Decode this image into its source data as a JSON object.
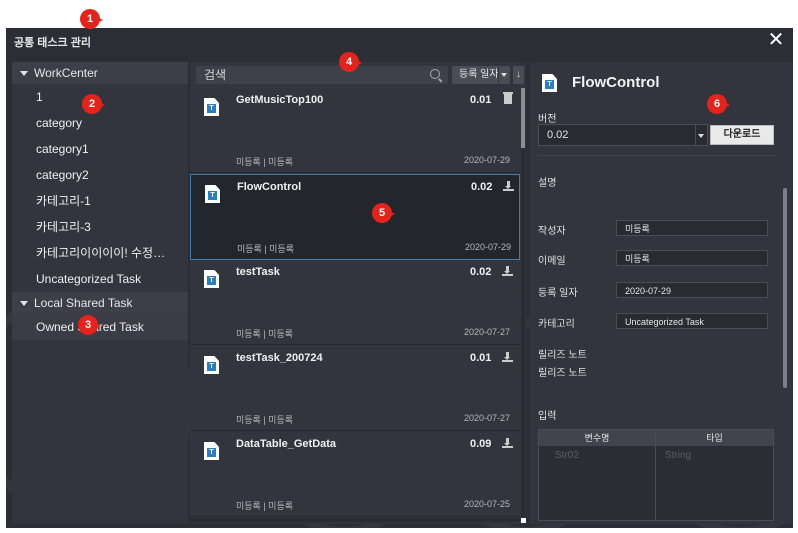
{
  "window": {
    "title": "공통 태스크 관리",
    "close_icon": "close-icon"
  },
  "markers": [
    "1",
    "2",
    "3",
    "4",
    "5",
    "6"
  ],
  "left_panel": {
    "groups": [
      {
        "label": "WorkCenter",
        "items": [
          "1",
          "category",
          "category1",
          "category2",
          "카테고리-1",
          "카테고리-3",
          "카테고리이이이이! 수정…",
          "Uncategorized Task"
        ]
      },
      {
        "label": "Local Shared Task",
        "items": [
          "Owned Shared Task"
        ]
      }
    ]
  },
  "middle_panel": {
    "search_placeholder": "검색",
    "sort_label": "등록 일자",
    "sort_dir_icon": "↓",
    "tasks": [
      {
        "name": "GetMusicTop100",
        "version": "0.01",
        "meta": "미등록 | 미등록",
        "date": "2020-07-29",
        "action": "trash-icon"
      },
      {
        "name": "FlowControl",
        "version": "0.02",
        "meta": "미등록 | 미등록",
        "date": "2020-07-29",
        "action": "download-icon",
        "selected": true
      },
      {
        "name": "testTask",
        "version": "0.02",
        "meta": "미등록 | 미등록",
        "date": "2020-07-27",
        "action": "download-icon"
      },
      {
        "name": "testTask_200724",
        "version": "0.01",
        "meta": "미등록 | 미등록",
        "date": "2020-07-27",
        "action": "download-icon"
      },
      {
        "name": "DataTable_GetData",
        "version": "0.09",
        "meta": "미등록 | 미등록",
        "date": "2020-07-25",
        "action": "download-icon"
      }
    ]
  },
  "detail": {
    "title": "FlowControl",
    "version_label": "버전",
    "version_value": "0.02",
    "download_button": "다운로드",
    "description_label": "설명",
    "author_label": "작성자",
    "author_value": "미등록",
    "email_label": "이메일",
    "email_value": "미등록",
    "date_label": "등록 일자",
    "date_value": "2020-07-29",
    "category_label": "카테고리",
    "category_value": "Uncategorized Task",
    "release_note_1": "릴리즈 노트",
    "release_note_2": "릴리즈 노트",
    "input_label": "입력",
    "table_headers": [
      "변수명",
      "타입"
    ],
    "table_rows": [
      [
        "Str02",
        "String"
      ]
    ]
  }
}
